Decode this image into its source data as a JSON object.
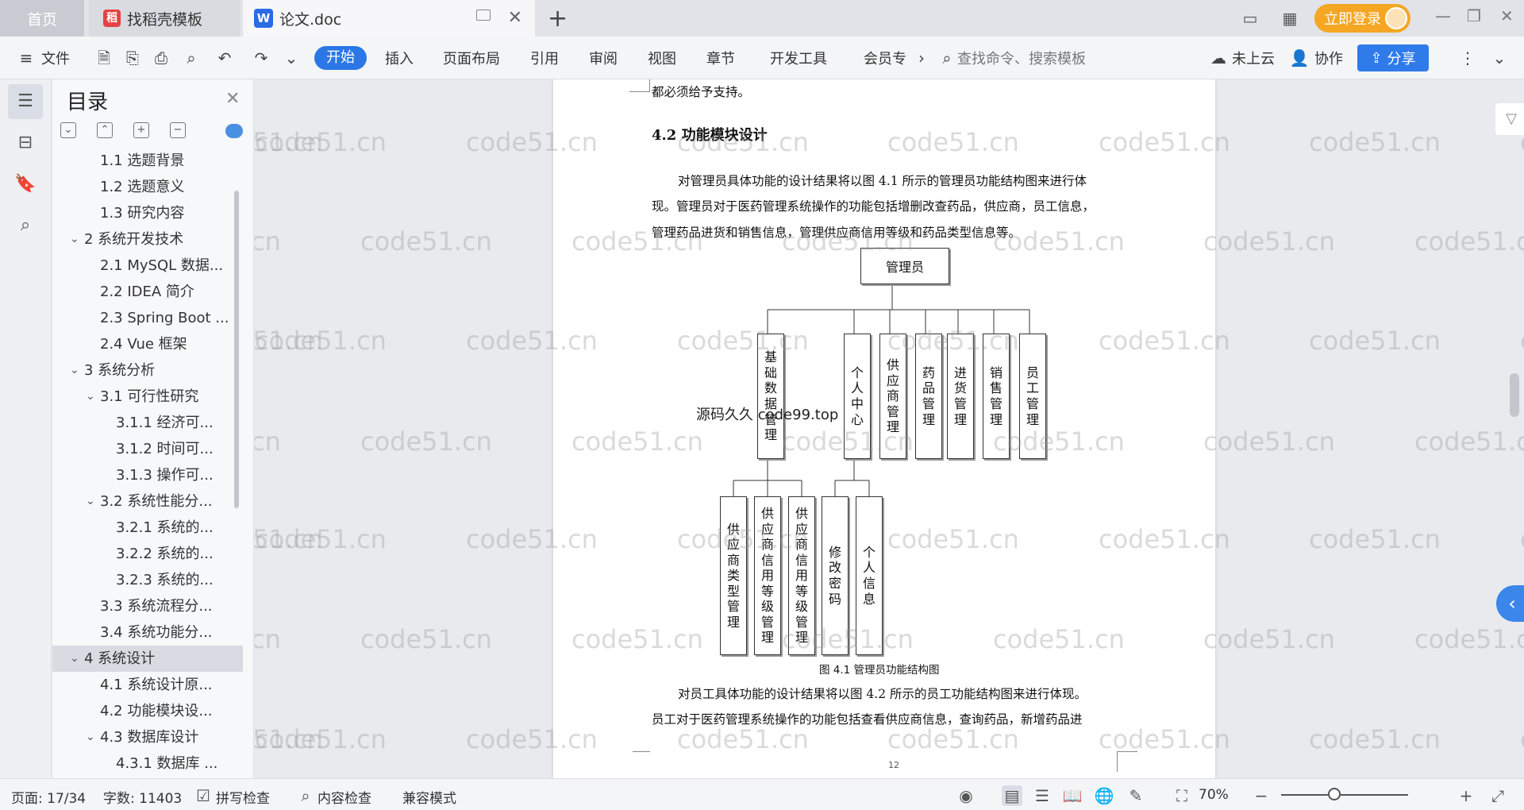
{
  "titlebar": {
    "home_tab": "首页",
    "tab1": "找稻壳模板",
    "tab2": "论文.doc",
    "login_label": "立即登录"
  },
  "ribbon": {
    "file": "文件",
    "tabs": [
      "开始",
      "插入",
      "页面布局",
      "引用",
      "审阅",
      "视图",
      "章节",
      "开发工具",
      "会员专"
    ],
    "search_placeholder": "查找命令、搜索模板",
    "cloud": "未上云",
    "collab": "协作",
    "share": "分享"
  },
  "toc": {
    "title": "目录",
    "items": [
      {
        "label": "1.1 选题背景",
        "level": 2
      },
      {
        "label": "1.2 选题意义",
        "level": 2
      },
      {
        "label": "1.3 研究内容",
        "level": 2
      },
      {
        "label": "2 系统开发技术",
        "level": 1
      },
      {
        "label": "2.1 MySQL 数据...",
        "level": 2
      },
      {
        "label": "2.2 IDEA 简介",
        "level": 2
      },
      {
        "label": "2.3 Spring Boot ...",
        "level": 2
      },
      {
        "label": "2.4 Vue 框架",
        "level": 2
      },
      {
        "label": "3 系统分析",
        "level": 1
      },
      {
        "label": "3.1 可行性研究",
        "level": 2
      },
      {
        "label": "3.1.1 经济可...",
        "level": 3
      },
      {
        "label": "3.1.2 时间可...",
        "level": 3
      },
      {
        "label": "3.1.3 操作可...",
        "level": 3
      },
      {
        "label": "3.2 系统性能分...",
        "level": 2
      },
      {
        "label": "3.2.1 系统的...",
        "level": 3
      },
      {
        "label": "3.2.2 系统的...",
        "level": 3
      },
      {
        "label": "3.2.3 系统的...",
        "level": 3
      },
      {
        "label": "3.3 系统流程分...",
        "level": 2
      },
      {
        "label": "3.4 系统功能分...",
        "level": 2
      },
      {
        "label": "4 系统设计",
        "level": 1
      },
      {
        "label": "4.1 系统设计原...",
        "level": 2
      },
      {
        "label": "4.2 功能模块设...",
        "level": 2
      },
      {
        "label": "4.3 数据库设计",
        "level": 2
      },
      {
        "label": "4.3.1 数据库 ...",
        "level": 3
      }
    ]
  },
  "doc": {
    "top_line": "都必须给予支持。",
    "heading": "4.2 功能模块设计",
    "para1_line1": "对管理员具体功能的设计结果将以图 4.1 所示的管理员功能结构图来进行体",
    "para1_line2": "现。管理员对于医药管理系统操作的功能包括增删改查药品，供应商，员工信息，",
    "para1_line3": "管理药品进货和销售信息，管理供应商信用等级和药品类型信息等。",
    "chart_root": "管理员",
    "level1": [
      "基础数据管理",
      "个人中心",
      "供应商管理",
      "药品管理",
      "进货管理",
      "销售管理",
      "员工管理"
    ],
    "level2_base": [
      "供应商类型管理",
      "供应商信用等级管理",
      "供应商信用等级管理"
    ],
    "level2_personal": [
      "修改密码",
      "个人信息"
    ],
    "caption": "图 4.1 管理员功能结构图",
    "para2_line1": "对员工具体功能的设计结果将以图 4.2 所示的员工功能结构图来进行体现。",
    "para2_line2": "员工对于医药管理系统操作的功能包括查看供应商信息，查询药品，新增药品进",
    "page_number": "12",
    "overlay_text": "源码久久 code99.top"
  },
  "watermark": "code51.cn",
  "status": {
    "page": "页面: 17/34",
    "words": "字数: 11403",
    "spell": "拼写检查",
    "content_check": "内容检查",
    "compat": "兼容模式",
    "zoom": "70%"
  }
}
